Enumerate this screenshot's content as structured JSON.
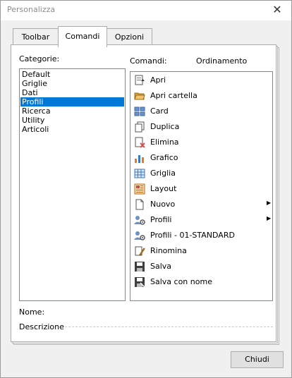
{
  "window": {
    "title": "Personalizza",
    "close_glyph": "✕"
  },
  "tabs": [
    {
      "label": "Toolbar",
      "active": false
    },
    {
      "label": "Comandi",
      "active": true
    },
    {
      "label": "Opzioni",
      "active": false
    }
  ],
  "categories": {
    "label": "Categorie:",
    "items": [
      "Default",
      "Griglie",
      "Dati",
      "Profili",
      "Ricerca",
      "Utility",
      "Articoli"
    ],
    "selected": "Profili"
  },
  "commands": {
    "label": "Comandi:",
    "sort_label": "Ordinamento",
    "items": [
      {
        "label": "Apri",
        "icon": "open-document-icon",
        "submenu": false
      },
      {
        "label": "Apri cartella",
        "icon": "folder-icon",
        "submenu": false
      },
      {
        "label": "Card",
        "icon": "card-icon",
        "submenu": false
      },
      {
        "label": "Duplica",
        "icon": "duplicate-icon",
        "submenu": false
      },
      {
        "label": "Elimina",
        "icon": "delete-document-icon",
        "submenu": false
      },
      {
        "label": "Grafico",
        "icon": "chart-icon",
        "submenu": false
      },
      {
        "label": "Griglia",
        "icon": "grid-icon",
        "submenu": false
      },
      {
        "label": "Layout",
        "icon": "layout-icon",
        "submenu": false
      },
      {
        "label": "Nuovo",
        "icon": "new-document-icon",
        "submenu": true,
        "arrow": "▶"
      },
      {
        "label": "Profili",
        "icon": "profiles-icon",
        "submenu": true,
        "arrow": "▶"
      },
      {
        "label": "Profili - 01-STANDARD",
        "icon": "profiles-icon",
        "submenu": false
      },
      {
        "label": "Rinomina",
        "icon": "rename-icon",
        "submenu": false
      },
      {
        "label": "Salva",
        "icon": "save-icon",
        "submenu": false
      },
      {
        "label": "Salva con nome",
        "icon": "save-as-icon",
        "submenu": false
      }
    ]
  },
  "details": {
    "name_label": "Nome:",
    "description_label": "Descrizione"
  },
  "footer": {
    "close_button": "Chiudi"
  }
}
